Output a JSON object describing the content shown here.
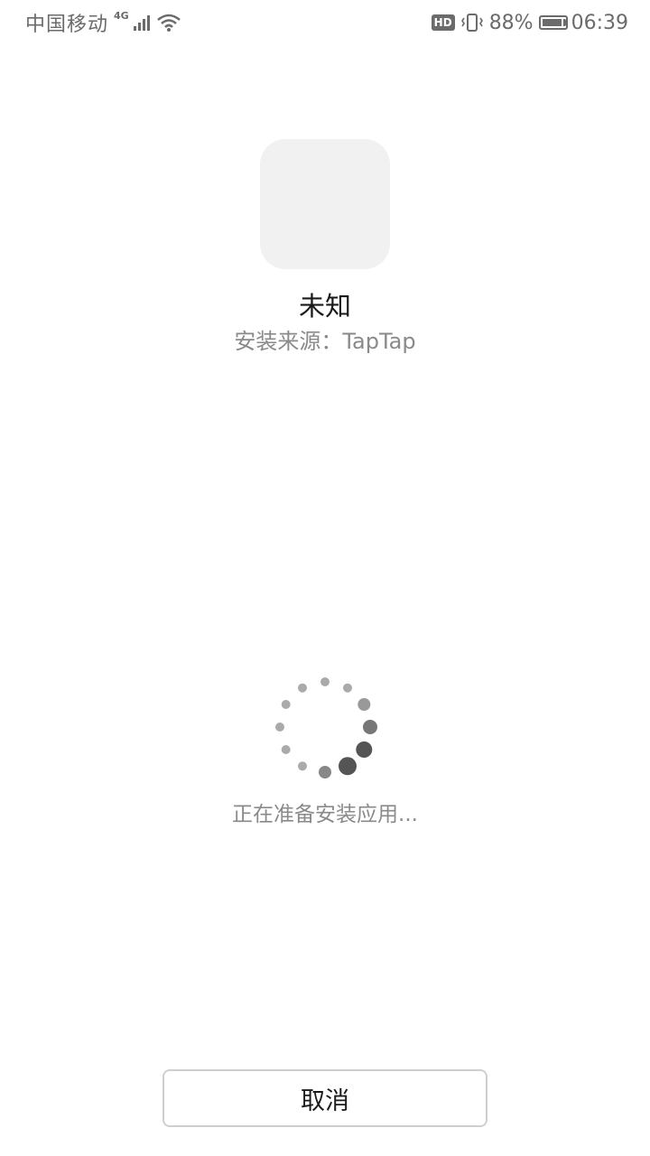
{
  "status_bar": {
    "carrier": "中国移动",
    "network_type": "4G",
    "hd_label": "HD",
    "battery_percent": "88%",
    "battery_level": 0.88,
    "time": "06:39"
  },
  "app": {
    "name": "未知",
    "install_source": "安装来源：TapTap"
  },
  "progress": {
    "status_text": "正在准备安装应用..."
  },
  "actions": {
    "cancel_label": "取消"
  },
  "colors": {
    "background": "#ffffff",
    "icon_placeholder": "#f1f1f1",
    "secondary_text": "#8a8a8a",
    "primary_text": "#1a1a1a",
    "spinner_dark": "#555555",
    "spinner_light": "#aaaaaa"
  }
}
